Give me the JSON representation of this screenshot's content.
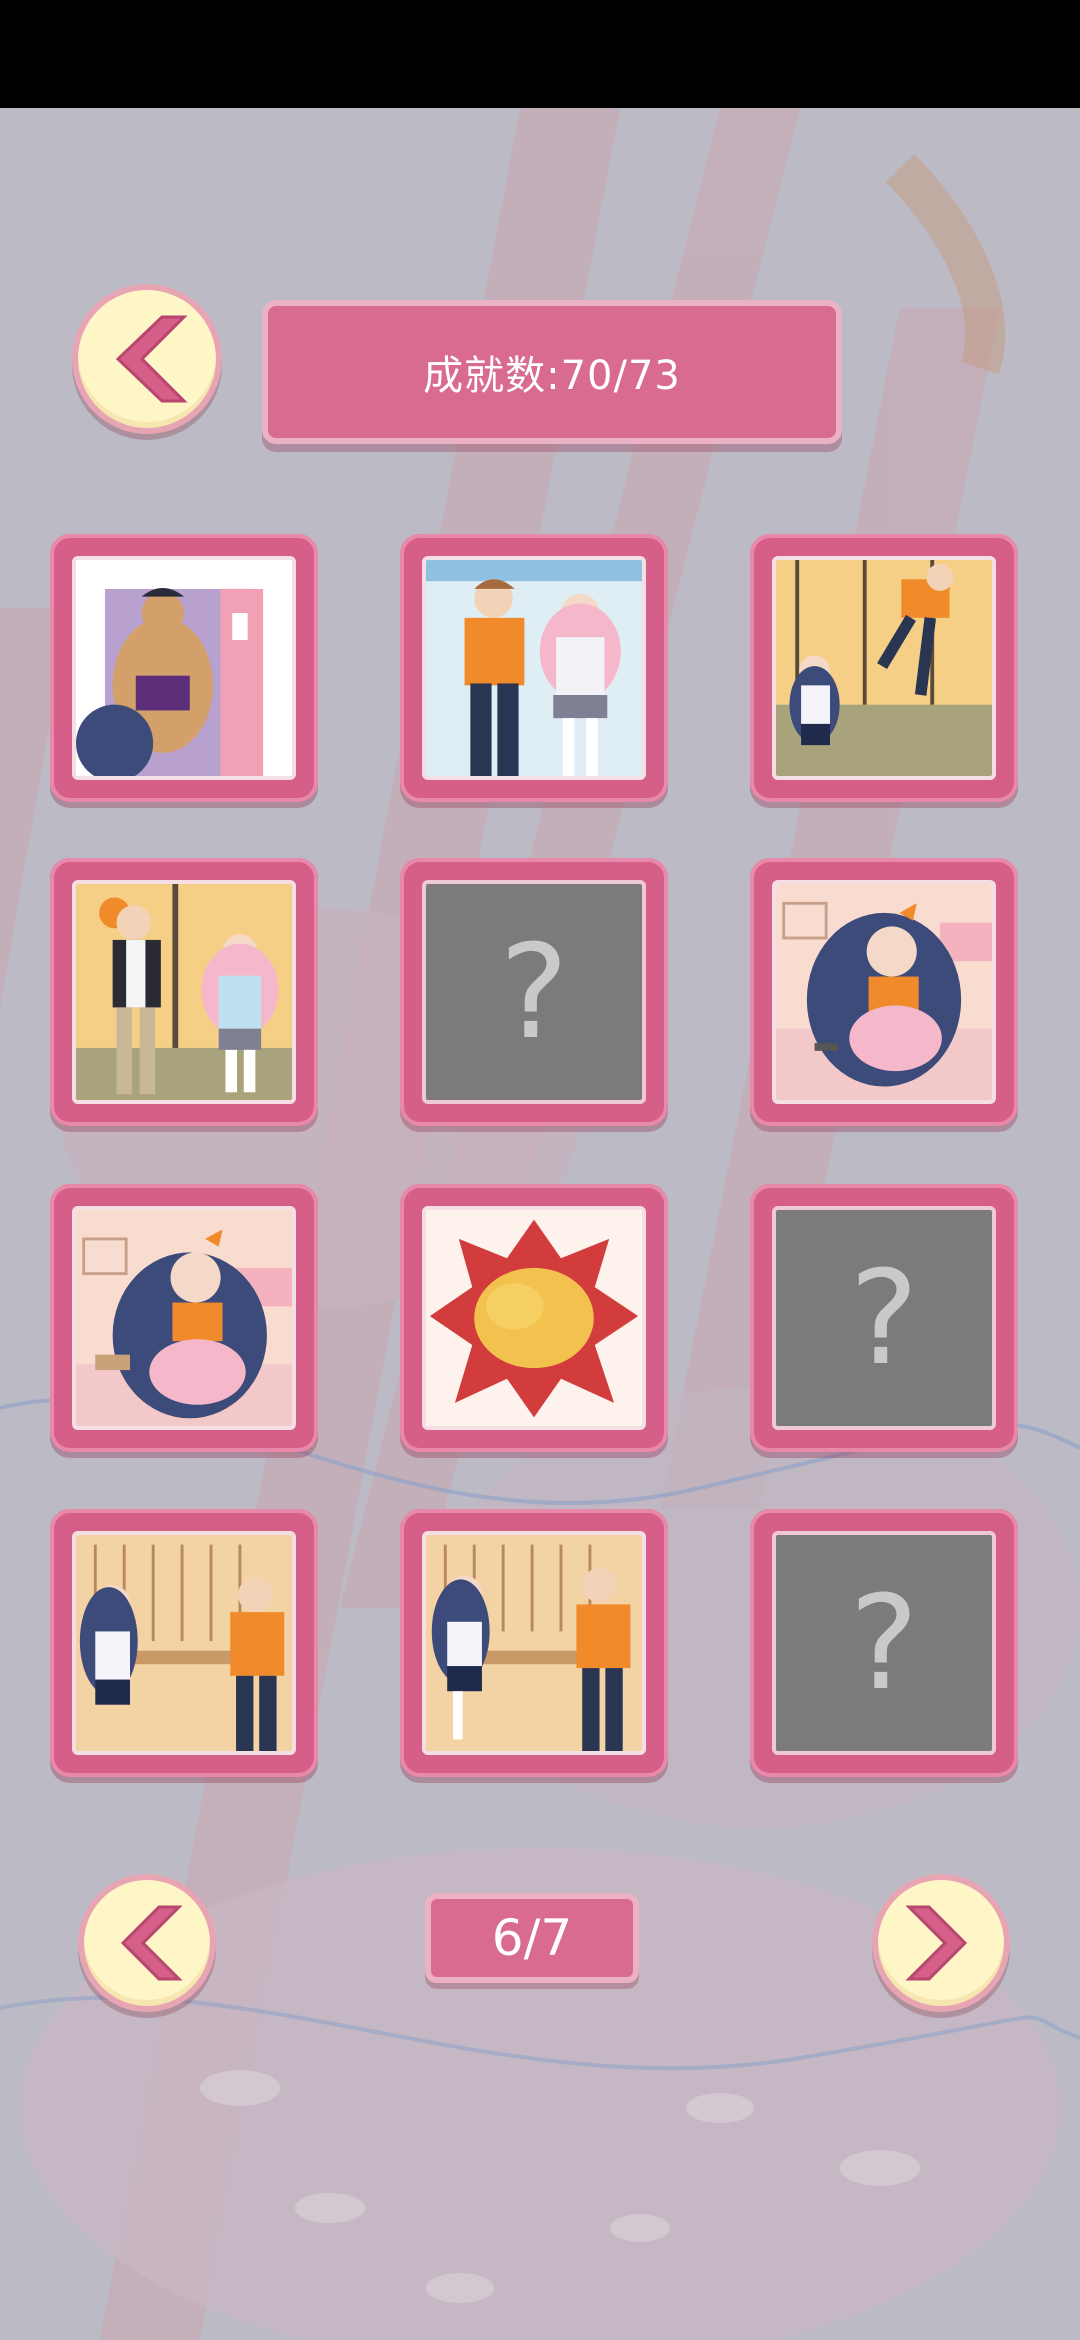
{
  "header": {
    "achievement_text": "成就数:70/73"
  },
  "pagination": {
    "page_label": "6/7"
  },
  "tiles": [
    {
      "state": "unlocked",
      "scene": "bathroom-door-muscle-man"
    },
    {
      "state": "unlocked",
      "scene": "boy-and-pink-hair-girl-standing"
    },
    {
      "state": "unlocked",
      "scene": "boy-running-out-door"
    },
    {
      "state": "unlocked",
      "scene": "three-students-hallway"
    },
    {
      "state": "locked",
      "label": "?"
    },
    {
      "state": "unlocked",
      "scene": "girl-kneeling-on-bed"
    },
    {
      "state": "unlocked",
      "scene": "girl-kneeling-bed-object"
    },
    {
      "state": "unlocked",
      "scene": "explosion"
    },
    {
      "state": "locked",
      "label": "?"
    },
    {
      "state": "unlocked",
      "scene": "classroom-handoff"
    },
    {
      "state": "unlocked",
      "scene": "classroom-reaching"
    },
    {
      "state": "locked",
      "label": "?"
    }
  ],
  "icons": {
    "back": "chevron-left-icon",
    "prev": "chevron-left-icon",
    "next": "chevron-right-icon"
  },
  "colors": {
    "accent_pink": "#d96a90",
    "button_cream": "#fff6c8",
    "locked_gray": "#7b7b7b"
  }
}
